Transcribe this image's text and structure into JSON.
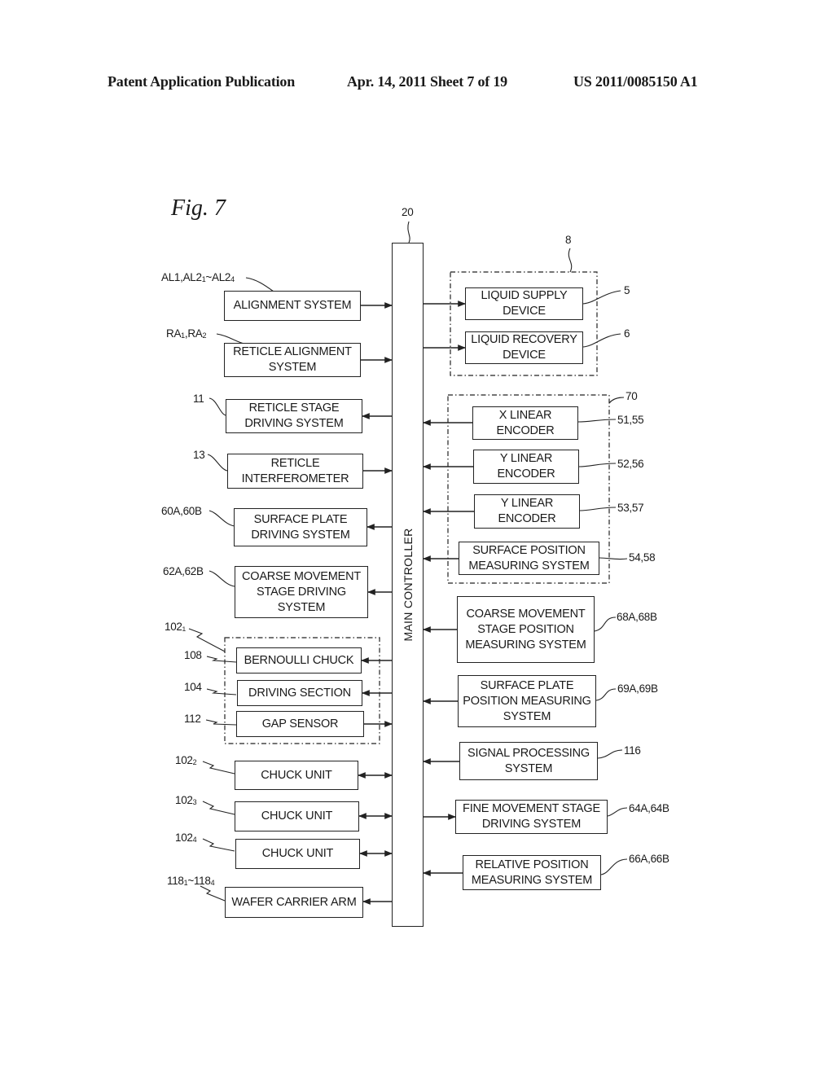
{
  "header": {
    "publication": "Patent Application Publication",
    "date_sheet": "Apr. 14, 2011  Sheet 7 of 19",
    "number": "US 2011/0085150 A1"
  },
  "figure": {
    "title": "Fig. 7",
    "controller": {
      "label": "MAIN CONTROLLER",
      "ref": "20"
    },
    "groups": {
      "liquid_group_ref": "8",
      "encoder_group_ref": "70",
      "chuck_group_ref": "102₁"
    },
    "left_blocks": [
      {
        "label": "ALIGNMENT SYSTEM",
        "ref": "AL1,AL2₁~AL2₄",
        "direction": "to-controller"
      },
      {
        "label": "RETICLE ALIGNMENT SYSTEM",
        "ref": "RA₁,RA₂",
        "direction": "to-controller"
      },
      {
        "label": "RETICLE STAGE DRIVING SYSTEM",
        "ref": "11",
        "direction": "from-controller"
      },
      {
        "label": "RETICLE INTERFEROMETER",
        "ref": "13",
        "direction": "to-controller"
      },
      {
        "label": "SURFACE PLATE DRIVING SYSTEM",
        "ref": "60A,60B",
        "direction": "from-controller"
      },
      {
        "label": "COARSE MOVEMENT STAGE DRIVING SYSTEM",
        "ref": "62A,62B",
        "direction": "from-controller"
      },
      {
        "label": "BERNOULLI CHUCK",
        "ref": "108",
        "direction": "from-controller"
      },
      {
        "label": "DRIVING SECTION",
        "ref": "104",
        "direction": "from-controller"
      },
      {
        "label": "GAP SENSOR",
        "ref": "112",
        "direction": "to-controller"
      },
      {
        "label": "CHUCK UNIT",
        "ref": "102₂",
        "direction": "bidirectional"
      },
      {
        "label": "CHUCK UNIT",
        "ref": "102₃",
        "direction": "bidirectional"
      },
      {
        "label": "CHUCK UNIT",
        "ref": "102₄",
        "direction": "bidirectional"
      },
      {
        "label": "WAFER CARRIER ARM",
        "ref": "118₁~118₄",
        "direction": "from-controller"
      }
    ],
    "right_blocks": [
      {
        "label": "LIQUID SUPPLY DEVICE",
        "ref": "5",
        "direction": "from-controller"
      },
      {
        "label": "LIQUID RECOVERY DEVICE",
        "ref": "6",
        "direction": "from-controller"
      },
      {
        "label": "X LINEAR ENCODER",
        "ref": "51,55",
        "direction": "to-controller"
      },
      {
        "label": "Y LINEAR ENCODER",
        "ref": "52,56",
        "direction": "to-controller"
      },
      {
        "label": "Y LINEAR ENCODER",
        "ref": "53,57",
        "direction": "to-controller"
      },
      {
        "label": "SURFACE POSITION MEASURING SYSTEM",
        "ref": "54,58",
        "direction": "to-controller"
      },
      {
        "label": "COARSE MOVEMENT STAGE POSITION MEASURING SYSTEM",
        "ref": "68A,68B",
        "direction": "to-controller"
      },
      {
        "label": "SURFACE PLATE POSITION MEASURING SYSTEM",
        "ref": "69A,69B",
        "direction": "to-controller"
      },
      {
        "label": "SIGNAL PROCESSING SYSTEM",
        "ref": "116",
        "direction": "to-controller"
      },
      {
        "label": "FINE MOVEMENT STAGE DRIVING SYSTEM",
        "ref": "64A,64B",
        "direction": "from-controller"
      },
      {
        "label": "RELATIVE POSITION MEASURING SYSTEM",
        "ref": "66A,66B",
        "direction": "to-controller"
      }
    ]
  }
}
